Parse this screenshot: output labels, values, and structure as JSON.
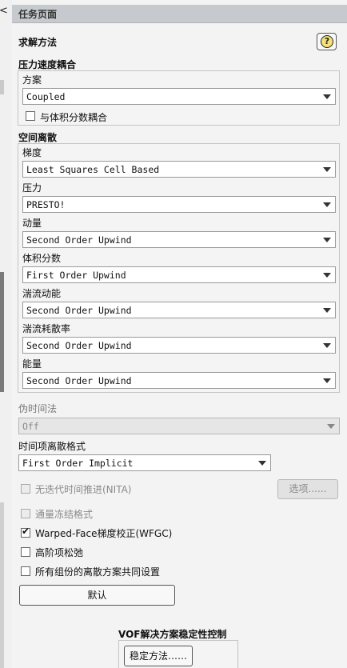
{
  "panel": {
    "title": "任务页面",
    "collapse_glyph": "<",
    "help_glyph": "?"
  },
  "method": {
    "title": "求解方法",
    "pv_coupling": {
      "title": "压力速度耦合",
      "scheme_label": "方案",
      "scheme_value": "Coupled",
      "coupled_vf_label": "与体积分数耦合",
      "coupled_vf_checked": false
    },
    "spatial": {
      "title": "空间离散",
      "rows": [
        {
          "label": "梯度",
          "value": "Least Squares Cell Based"
        },
        {
          "label": "压力",
          "value": "PRESTO!"
        },
        {
          "label": "动量",
          "value": "Second Order Upwind"
        },
        {
          "label": "体积分数",
          "value": "First Order Upwind"
        },
        {
          "label": "湍流动能",
          "value": "Second Order Upwind"
        },
        {
          "label": "湍流耗散率",
          "value": "Second Order Upwind"
        },
        {
          "label": "能量",
          "value": "Second Order Upwind"
        }
      ]
    },
    "pseudo_time": {
      "label": "伪时间法",
      "value": "Off"
    },
    "transient": {
      "label": "时间项离散格式",
      "value": "First Order Implicit"
    },
    "nita": {
      "label": "无迭代时间推进(NITA)",
      "checked": false,
      "enabled": false
    },
    "options_button": "选项......",
    "frozen_flux": {
      "label": "通量冻结格式",
      "checked": false,
      "enabled": false
    },
    "wfgc": {
      "label": "Warped-Face梯度校正(WFGC)",
      "checked": true
    },
    "high_order_relax": {
      "label": "高阶项松弛",
      "checked": false
    },
    "all_groups": {
      "label": "所有组份的离散方案共同设置",
      "checked": false
    },
    "default_button": "默认",
    "vof": {
      "title": "VOF解决方案稳定性控制",
      "button": "稳定方法……"
    }
  },
  "colors": {
    "title_bar": "#c6c9ce",
    "panel_bg": "#f3f3f3",
    "help_icon": "#f5e07a"
  }
}
